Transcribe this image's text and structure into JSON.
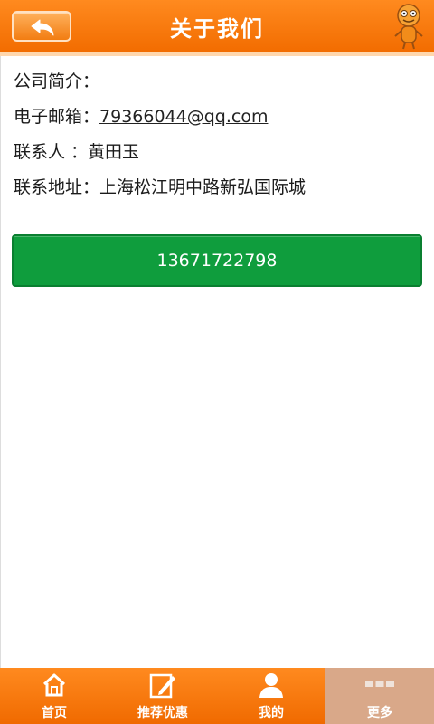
{
  "header": {
    "title": "关于我们"
  },
  "info": {
    "company_label": "公司简介：",
    "email_label": "电子邮箱：",
    "email_value": "79366044@qq.com",
    "contact_label": "联系人 ：",
    "contact_value": "黄田玉",
    "address_label": "联系地址：",
    "address_value": "上海松江明中路新弘国际城"
  },
  "phone_button": {
    "label": "13671722798"
  },
  "tabs": [
    {
      "label": "首页",
      "icon": "home-icon"
    },
    {
      "label": "推荐优惠",
      "icon": "edit-icon"
    },
    {
      "label": "我的",
      "icon": "user-icon"
    },
    {
      "label": "更多",
      "icon": "more-icon",
      "active": true
    }
  ],
  "colors": {
    "accent": "#f57400",
    "button_green": "#0f9d3d",
    "active_tab": "#d9a889"
  }
}
